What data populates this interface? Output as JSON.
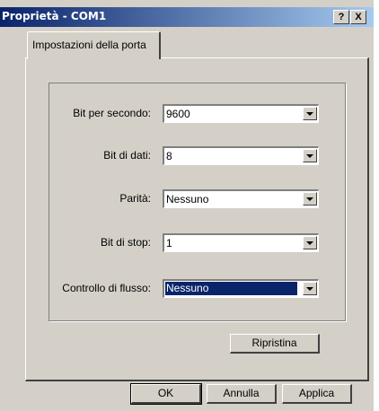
{
  "window": {
    "title": "Proprietà - COM1",
    "help_label": "?",
    "close_label": "X"
  },
  "tabs": [
    {
      "label": "Impostazioni della porta"
    }
  ],
  "settings": [
    {
      "label": "Bit per secondo:",
      "value": "9600"
    },
    {
      "label": "Bit di dati:",
      "value": "8"
    },
    {
      "label": "Parità:",
      "value": "Nessuno"
    },
    {
      "label": "Bit di stop:",
      "value": "1"
    },
    {
      "label": "Controllo di flusso:",
      "value": "Nessuno"
    }
  ],
  "buttons": {
    "restore": "Ripristina",
    "ok": "OK",
    "cancel": "Annulla",
    "apply": "Applica"
  }
}
